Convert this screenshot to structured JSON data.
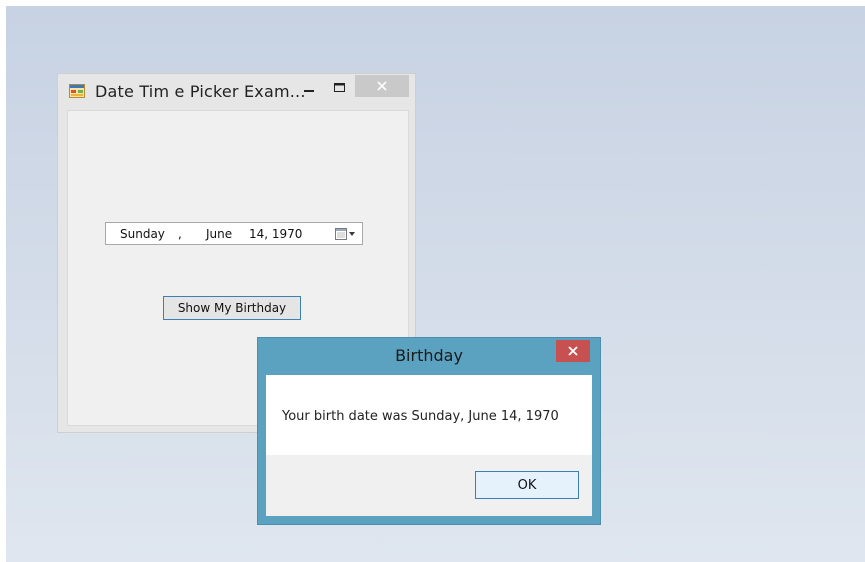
{
  "main_window": {
    "title": "Date Tim e Picker Exam...",
    "date_picker": {
      "day_of_week": "Sunday",
      "separator": ",",
      "month": "June",
      "day_year": "14, 1970"
    },
    "show_button_label": "Show My Birthday"
  },
  "message_box": {
    "title": "Birthday",
    "message": "Your birth date was Sunday, June 14, 1970",
    "ok_label": "OK"
  },
  "colors": {
    "msgbox_frame": "#5aa2c0",
    "msgbox_close": "#c75050",
    "button_border": "#3c7fb1"
  },
  "icons": [
    "app-icon",
    "minimize-icon",
    "maximize-icon",
    "close-icon",
    "calendar-icon",
    "dropdown-arrow-icon"
  ]
}
